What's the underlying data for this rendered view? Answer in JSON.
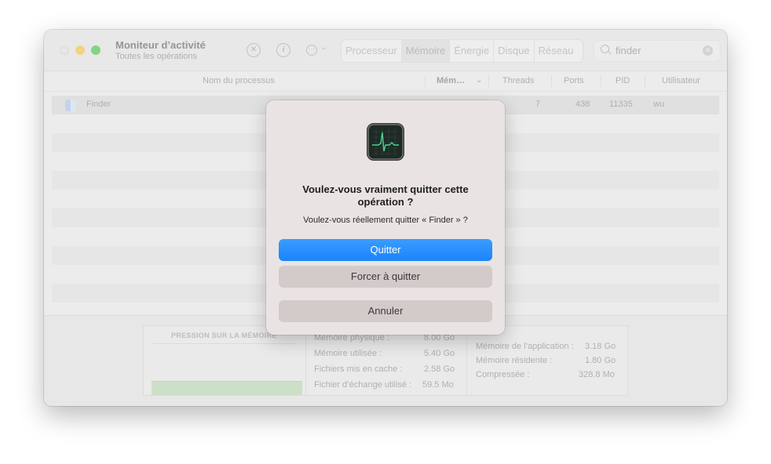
{
  "window": {
    "title": "Moniteur d’activité",
    "subtitle": "Toutes les opérations"
  },
  "toolbar": {
    "stop_icon": "x-circle-icon",
    "info_icon": "info-icon",
    "more_icon": "ellipsis-circle-icon",
    "tabs": [
      {
        "label": "Processeur",
        "active": false
      },
      {
        "label": "Mémoire",
        "active": true
      },
      {
        "label": "Énergie",
        "active": false
      },
      {
        "label": "Disque",
        "active": false
      },
      {
        "label": "Réseau",
        "active": false
      }
    ],
    "search": {
      "value": "finder"
    }
  },
  "table": {
    "columns": {
      "name": "Nom du processus",
      "memory": "Mém…",
      "threads": "Threads",
      "ports": "Ports",
      "pid": "PID",
      "user": "Utilisateur"
    },
    "rows": [
      {
        "name": "Finder",
        "threads": "7",
        "ports": "438",
        "pid": "11335",
        "user": "wu"
      }
    ]
  },
  "memory_panel": {
    "pressure_title": "PRESSION SUR LA MÉMOIRE",
    "middle": [
      {
        "label": "Mémoire physique :",
        "value": "8.00 Go"
      },
      {
        "label": "Mémoire utilisée :",
        "value": "5.40 Go"
      },
      {
        "label": "Fichiers mis en cache :",
        "value": "2.58 Go"
      },
      {
        "label": "Fichier d’échange utilisé :",
        "value": "59.5 Mo"
      }
    ],
    "right": [
      {
        "label": "Mémoire de l’application :",
        "value": "3.18 Go"
      },
      {
        "label": "Mémoire résidente :",
        "value": "1.80 Go"
      },
      {
        "label": "Compressée :",
        "value": "328.8 Mo"
      }
    ]
  },
  "dialog": {
    "icon": "activity-monitor-icon",
    "title": "Voulez-vous vraiment quitter cette opération ?",
    "message": "Voulez-vous réellement quitter « Finder » ?",
    "quit_label": "Quitter",
    "force_quit_label": "Forcer à quitter",
    "cancel_label": "Annuler",
    "accent": "#1a84fb"
  }
}
